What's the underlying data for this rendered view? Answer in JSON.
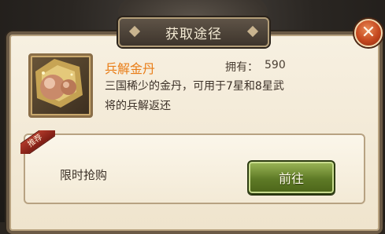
{
  "dialog": {
    "title": "获取途径",
    "close_label": "✕"
  },
  "item": {
    "name": "兵解金丹",
    "owned_label": "拥有：",
    "owned_value": "590",
    "description_line1": "三国稀少的金丹，可用于7星和8星武",
    "description_line2": "将的兵解返还",
    "icon": "golden-pill-icon"
  },
  "source": {
    "badge": "推荐",
    "label": "限时抢购",
    "go_button": "前往"
  },
  "colors": {
    "item_name": "#e97d17",
    "go_button": "#5e7a26",
    "close_button": "#c4471e"
  }
}
